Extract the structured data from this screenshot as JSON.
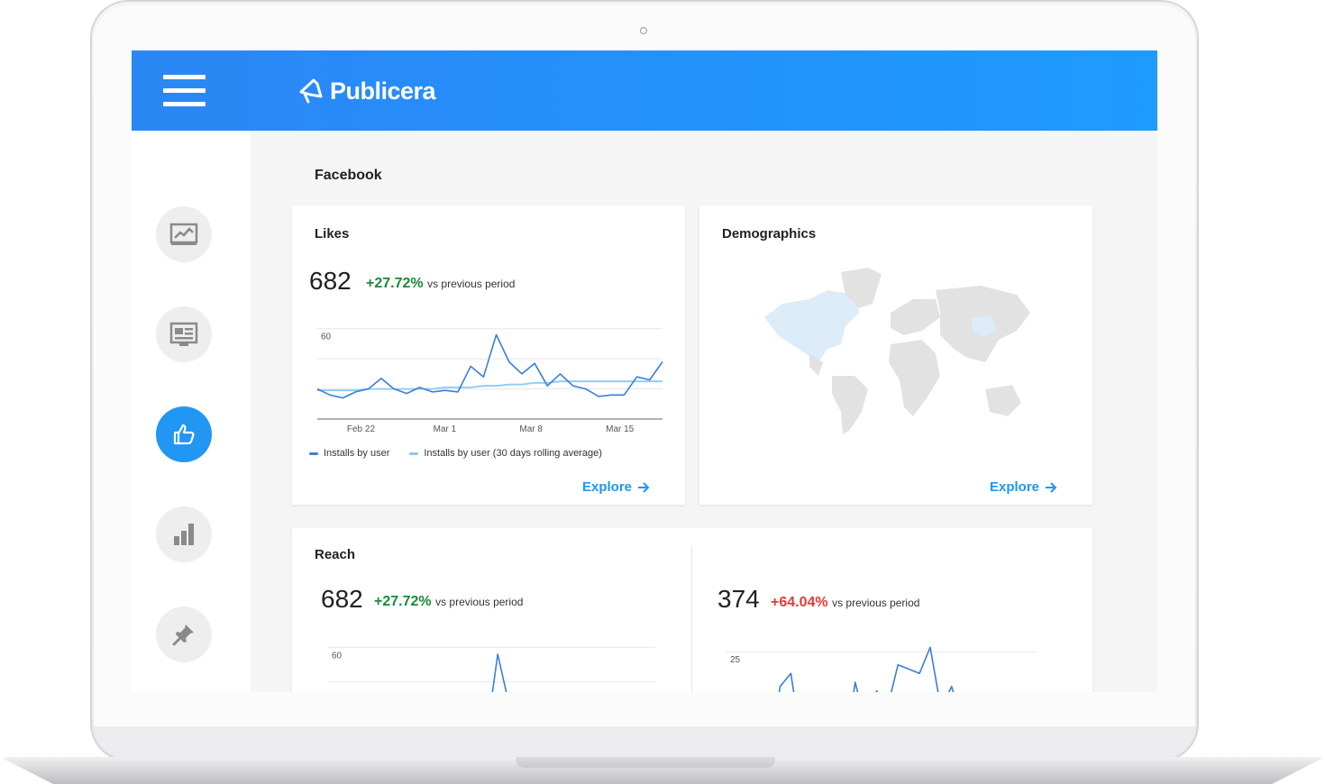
{
  "app": {
    "name": "Publicera"
  },
  "colors": {
    "accent": "#2196f3",
    "topbar": "#2b86f6",
    "positive": "#1a8a3a",
    "negative": "#e53935",
    "series_primary": "#3b7ddd",
    "series_secondary": "#8cc8f5"
  },
  "sidebar": {
    "items": [
      {
        "name": "analytics",
        "icon": "line-chart-icon",
        "active": false
      },
      {
        "name": "posts",
        "icon": "newspaper-icon",
        "active": false
      },
      {
        "name": "likes",
        "icon": "thumbs-up-icon",
        "active": true
      },
      {
        "name": "stats",
        "icon": "bar-chart-icon",
        "active": false
      },
      {
        "name": "pinned",
        "icon": "pin-icon",
        "active": false
      }
    ]
  },
  "main": {
    "title": "Facebook"
  },
  "likes": {
    "title": "Likes",
    "value": "682",
    "change": "+27.72%",
    "change_suffix": "vs previous period",
    "explore": "Explore",
    "legend": [
      "Installs by user",
      "Installs by user (30 days rolling average)"
    ]
  },
  "demographics": {
    "title": "Demographics",
    "explore": "Explore"
  },
  "reach": {
    "title": "Reach",
    "left": {
      "value": "682",
      "change": "+27.72%",
      "change_suffix": "vs previous period"
    },
    "right": {
      "value": "374",
      "change": "+64.04%",
      "change_suffix": "vs previous period"
    }
  },
  "chart_data": [
    {
      "id": "likes",
      "type": "line",
      "x_ticks": [
        "Feb 22",
        "Mar 1",
        "Mar 8",
        "Mar 15"
      ],
      "y_ticks": [
        "60"
      ],
      "ylim": [
        0,
        70
      ],
      "grid": true,
      "legend_position": "bottom-left",
      "series": [
        {
          "name": "Installs by user",
          "values": [
            20,
            16,
            14,
            18,
            20,
            27,
            20,
            17,
            21,
            18,
            19,
            18,
            35,
            28,
            56,
            38,
            30,
            37,
            22,
            30,
            22,
            20,
            15,
            16,
            16,
            28,
            26,
            38
          ]
        },
        {
          "name": "Installs by user (30 days rolling average)",
          "values": [
            19,
            19,
            19,
            19,
            20,
            20,
            20,
            20,
            20,
            20,
            21,
            21,
            21,
            22,
            22,
            23,
            23,
            24,
            24,
            25,
            25,
            25,
            25,
            25,
            25,
            25,
            25,
            25
          ]
        }
      ]
    },
    {
      "id": "reach-left",
      "type": "line",
      "y_ticks": [
        "60"
      ],
      "ylim": [
        0,
        70
      ],
      "grid": true,
      "series": [
        {
          "name": "",
          "values": [
            -2,
            -4,
            -8,
            -3,
            0,
            -6,
            -4,
            -10,
            -7,
            -2,
            -8,
            -7,
            14,
            6,
            56,
            25,
            10,
            17,
            1,
            9,
            0,
            0,
            0,
            -1,
            -1,
            5,
            -1,
            14
          ]
        },
        {
          "name": "",
          "values": [
            -2,
            -2,
            -2,
            -1,
            -1,
            -1,
            -1,
            -1,
            0,
            0,
            0,
            0,
            0,
            0,
            0,
            0,
            0,
            1,
            1,
            1,
            1,
            1,
            1,
            1,
            1,
            1,
            1,
            1
          ]
        }
      ]
    },
    {
      "id": "reach-right",
      "type": "line",
      "y_ticks": [
        "25"
      ],
      "ylim": [
        0,
        30
      ],
      "grid": true,
      "series": [
        {
          "name": "",
          "values": [
            1,
            -1,
            -2,
            2,
            1,
            17,
            20,
            4,
            12,
            12,
            13,
            2,
            18,
            8,
            16,
            12,
            22,
            21,
            20,
            26,
            12,
            17,
            8,
            15,
            14,
            13,
            13,
            2,
            -4,
            11
          ]
        },
        {
          "name": "",
          "values": [
            0,
            0,
            0,
            0,
            0,
            0,
            0,
            0,
            0,
            0,
            1,
            1,
            1,
            2,
            2,
            3,
            3,
            4,
            4,
            5,
            5,
            5,
            6,
            6,
            6,
            6,
            6,
            6,
            7,
            7
          ]
        }
      ]
    }
  ]
}
